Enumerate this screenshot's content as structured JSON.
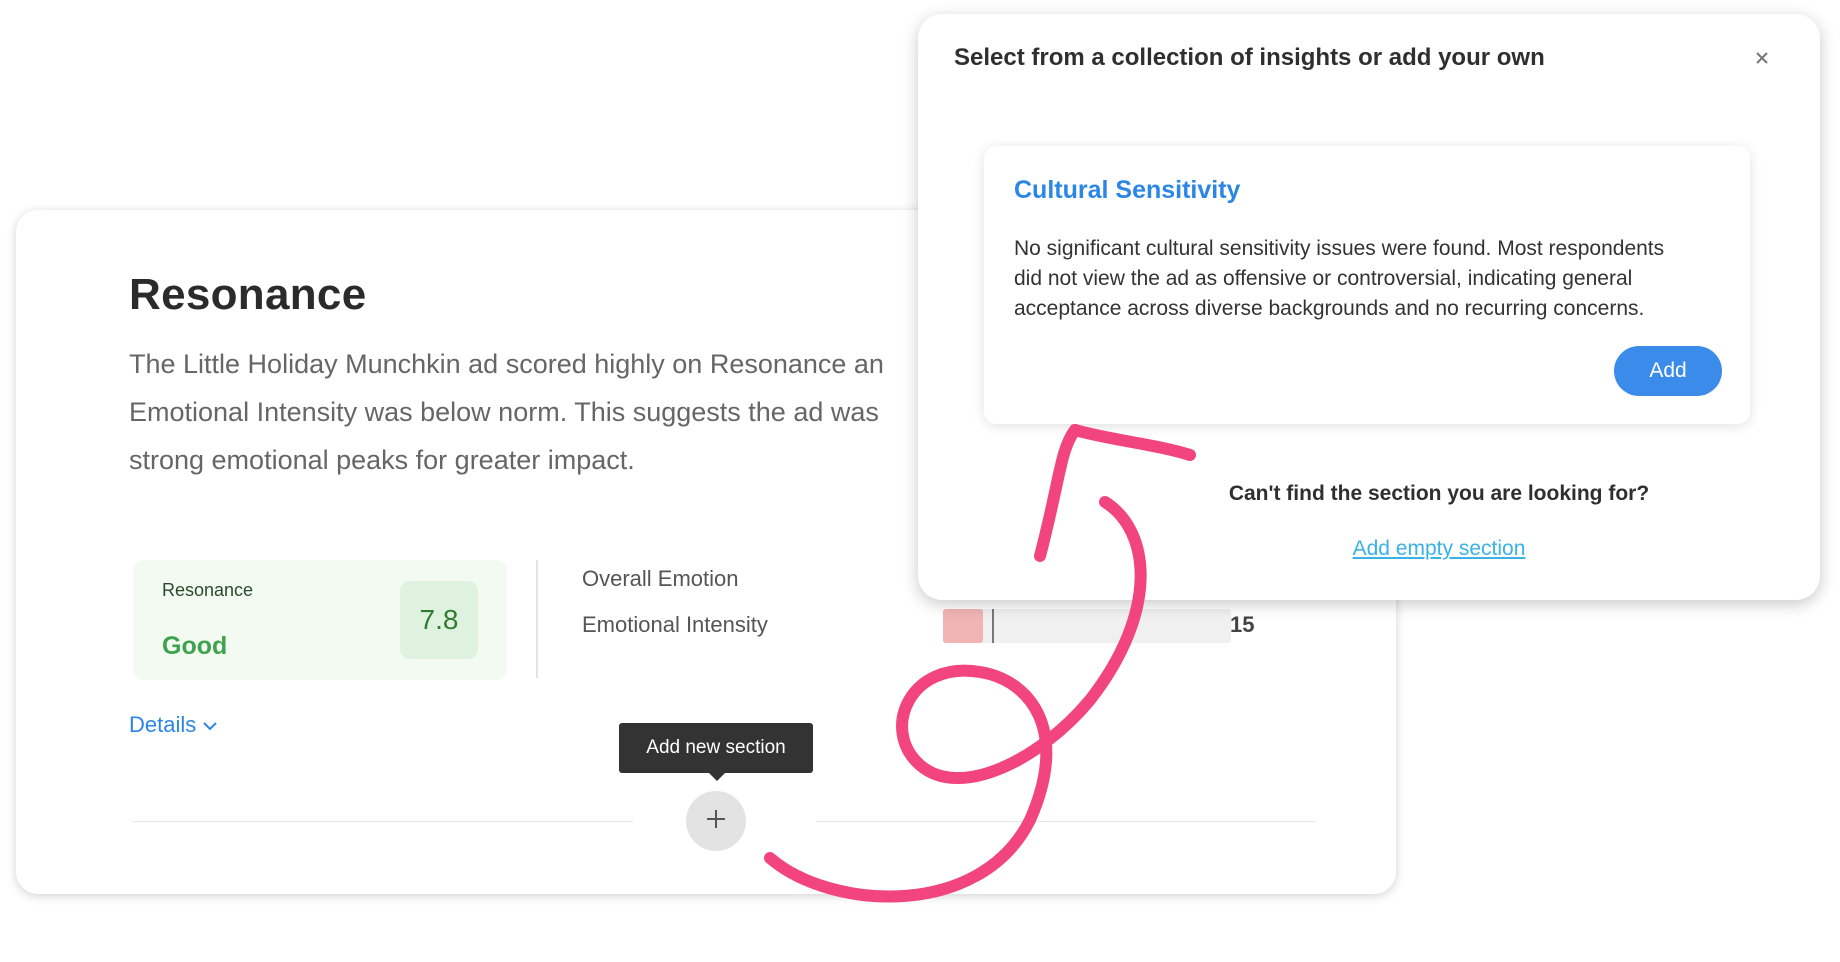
{
  "card": {
    "title": "Resonance",
    "description_lines": [
      "The Little Holiday Munchkin ad scored highly on Resonance an",
      "Emotional Intensity was below norm. This suggests the ad was",
      "strong emotional peaks for greater impact."
    ],
    "score": {
      "label": "Resonance",
      "rating": "Good",
      "value": "7.8"
    },
    "metrics": [
      {
        "label": "Overall Emotion"
      },
      {
        "label": "Emotional Intensity",
        "value": "15"
      }
    ],
    "details_label": "Details",
    "tooltip": "Add new section"
  },
  "modal": {
    "title": "Select from a collection of insights or add your own",
    "insight": {
      "title": "Cultural Sensitivity",
      "body_lines": [
        "No significant cultural sensitivity issues were found. Most respondents",
        "did not view the ad as offensive or controversial, indicating general",
        "acceptance across diverse backgrounds and no recurring concerns."
      ],
      "add_label": "Add"
    },
    "question": "Can't find the section you are looking for?",
    "link_label": "Add empty section"
  },
  "colors": {
    "accent_blue": "#2b86e6",
    "button_blue": "#3b8beb",
    "good_green": "#3fa34d",
    "annotation_pink": "#f2447e"
  }
}
